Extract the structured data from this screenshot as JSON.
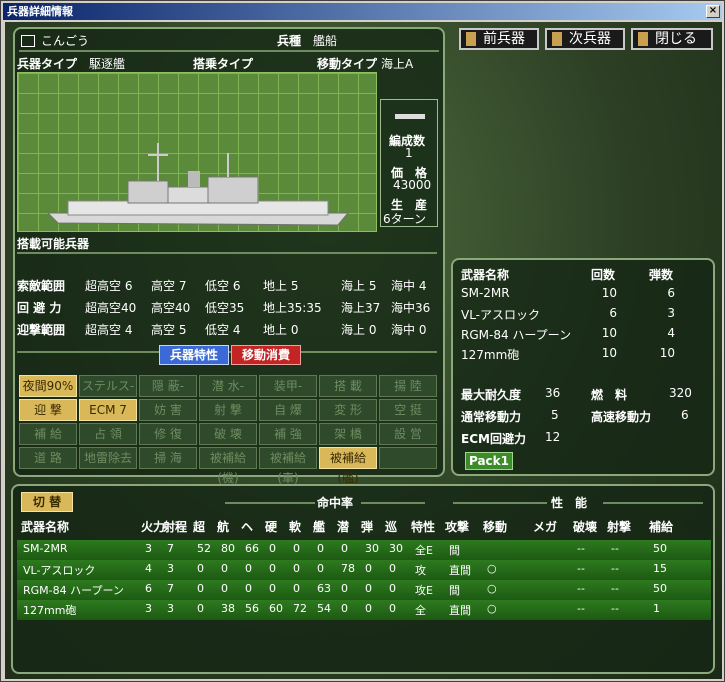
{
  "window": {
    "title": "兵器詳細情報",
    "close": "×"
  },
  "unit": {
    "name": "こんごう",
    "kind_label": "兵種",
    "kind": "艦船"
  },
  "types": {
    "weapon_type_label": "兵器タイプ",
    "weapon_type": "駆逐艦",
    "carry_type_label": "搭乗タイプ",
    "carry_type": "",
    "move_type_label": "移動タイプ",
    "move_type": "海上A"
  },
  "stats_box": {
    "formation_label": "編成数",
    "formation": "1",
    "price_label": "価　格",
    "price": "43000",
    "production_label": "生　産",
    "production": "6ターン"
  },
  "loadable_label": "搭載可能兵器",
  "ranges": [
    {
      "label": "索敵範囲",
      "v": [
        "超高空 6",
        "高空 7",
        "低空 6",
        "地上 5",
        "海上 5",
        "海中 4"
      ]
    },
    {
      "label": "回 避 力",
      "v": [
        "超高空40",
        "高空40",
        "低空35",
        "地上35:35",
        "海上37",
        "海中36"
      ]
    },
    {
      "label": "迎撃範囲",
      "v": [
        "超高空 4",
        "高空 5",
        "低空 4",
        "地上 0",
        "海上 0",
        "海中 0"
      ]
    }
  ],
  "tabs": {
    "traits": "兵器特性",
    "move_cost": "移動消費"
  },
  "abilities": [
    [
      "夜間90%",
      "ステルス-",
      "隠 蔽-",
      "潜 水-",
      "装甲-",
      "搭 載",
      "揚 陸"
    ],
    [
      "迎 撃",
      "ECM 7",
      "妨 害",
      "射 撃",
      "自 爆",
      "変 形",
      "空 挺"
    ],
    [
      "補 給",
      "占 領",
      "修 復",
      "破 壊",
      "補 強",
      "架 橋",
      "設 営"
    ],
    [
      "道 路",
      "地雷除去",
      "掃 海",
      "被補給(機)",
      "被補給(車)",
      "被補給(艦)",
      ""
    ]
  ],
  "ability_on": [
    [
      true,
      false,
      false,
      false,
      false,
      false,
      false
    ],
    [
      true,
      true,
      false,
      false,
      false,
      false,
      false
    ],
    [
      false,
      false,
      false,
      false,
      false,
      false,
      false
    ],
    [
      false,
      false,
      false,
      false,
      false,
      true,
      false
    ]
  ],
  "nav": {
    "prev": "前兵器",
    "next": "次兵器",
    "close": "閉じる"
  },
  "weapons_summary": {
    "headers": [
      "武器名称",
      "回数",
      "弾数"
    ],
    "rows": [
      [
        "SM-2MR",
        "10",
        "6"
      ],
      [
        "VL-アスロック",
        "6",
        "3"
      ],
      [
        "RGM-84 ハープーン",
        "10",
        "4"
      ],
      [
        "127mm砲",
        "10",
        "10"
      ]
    ]
  },
  "durability": {
    "max_hp_label": "最大耐久度",
    "max_hp": "36",
    "fuel_label": "燃　料",
    "fuel": "320",
    "normal_move_label": "通常移動力",
    "normal_move": "5",
    "fast_move_label": "高速移動力",
    "fast_move": "6",
    "ecm_label": "ECM回避力",
    "ecm": "12",
    "pack": "Pack1"
  },
  "weapons_detail": {
    "switch": "切 替",
    "group_hit": "命中率",
    "group_perf": "性　能",
    "headers": [
      "武器名称",
      "火力",
      "射程",
      "超",
      "航",
      "ヘ",
      "硬",
      "軟",
      "艦",
      "潜",
      "弾",
      "巡",
      "特性",
      "攻撃",
      "移動",
      "メガ",
      "破壊",
      "射撃",
      "補給"
    ],
    "rows": [
      [
        "SM-2MR",
        "3",
        "7",
        "52",
        "80",
        "66",
        "0",
        "0",
        "0",
        "0",
        "30",
        "30",
        "全E",
        "間",
        "",
        "",
        "--",
        "--",
        "50"
      ],
      [
        "VL-アスロック",
        "4",
        "3",
        "0",
        "0",
        "0",
        "0",
        "0",
        "0",
        "78",
        "0",
        "0",
        "攻",
        "直間",
        "○",
        "",
        "--",
        "--",
        "15"
      ],
      [
        "RGM-84 ハープーン",
        "6",
        "7",
        "0",
        "0",
        "0",
        "0",
        "0",
        "63",
        "0",
        "0",
        "0",
        "攻E",
        "間",
        "○",
        "",
        "--",
        "--",
        "50"
      ],
      [
        "127mm砲",
        "3",
        "3",
        "0",
        "38",
        "56",
        "60",
        "72",
        "54",
        "0",
        "0",
        "0",
        "全",
        "直間",
        "○",
        "",
        "--",
        "--",
        "1"
      ]
    ]
  }
}
